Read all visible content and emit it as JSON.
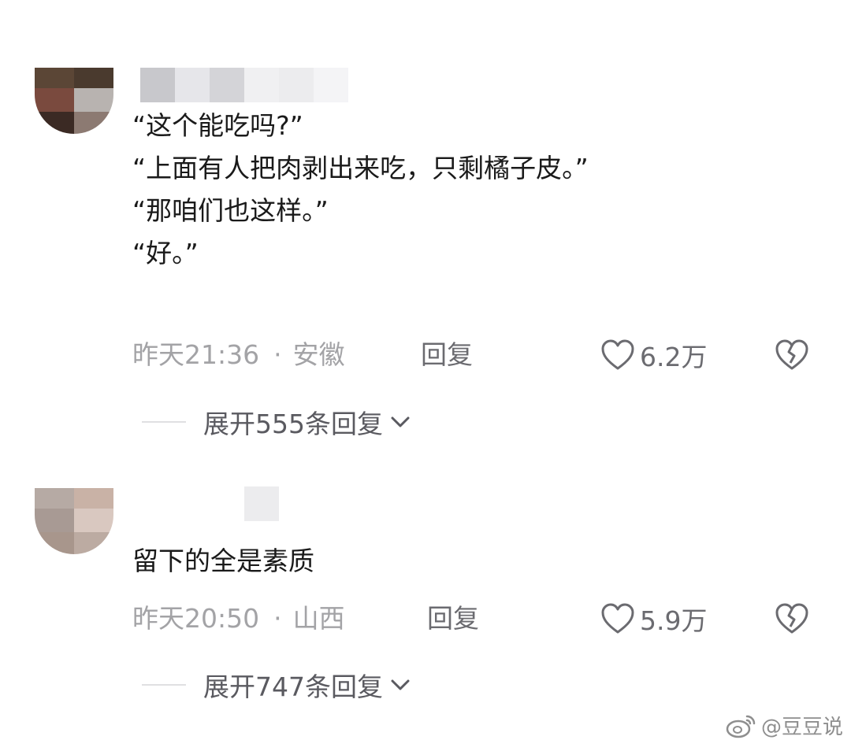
{
  "comments": [
    {
      "content_lines": [
        "“这个能吃吗?”",
        "“上面有人把肉剥出来吃，只剩橘子皮。”",
        "“那咱们也这样。”",
        "“好。”"
      ],
      "time": "昨天21:36",
      "separator": "·",
      "location": "安徽",
      "reply_label": "回复",
      "likes": "6.2万",
      "expand_label": "展开555条回复"
    },
    {
      "content_lines": [
        "留下的全是素质"
      ],
      "time": "昨天20:50",
      "separator": "·",
      "location": "山西",
      "reply_label": "回复",
      "likes": "5.9万",
      "expand_label": "展开747条回复"
    }
  ],
  "icons": {
    "like": "heart-outline-icon",
    "dislike": "broken-heart-icon",
    "expand": "chevron-down-icon",
    "watermark": "weibo-logo-icon"
  },
  "watermark": {
    "text": "@豆豆说"
  },
  "colors": {
    "meta": "#a3a3a6",
    "action": "#6b6b70",
    "text": "#1a1a1a"
  }
}
